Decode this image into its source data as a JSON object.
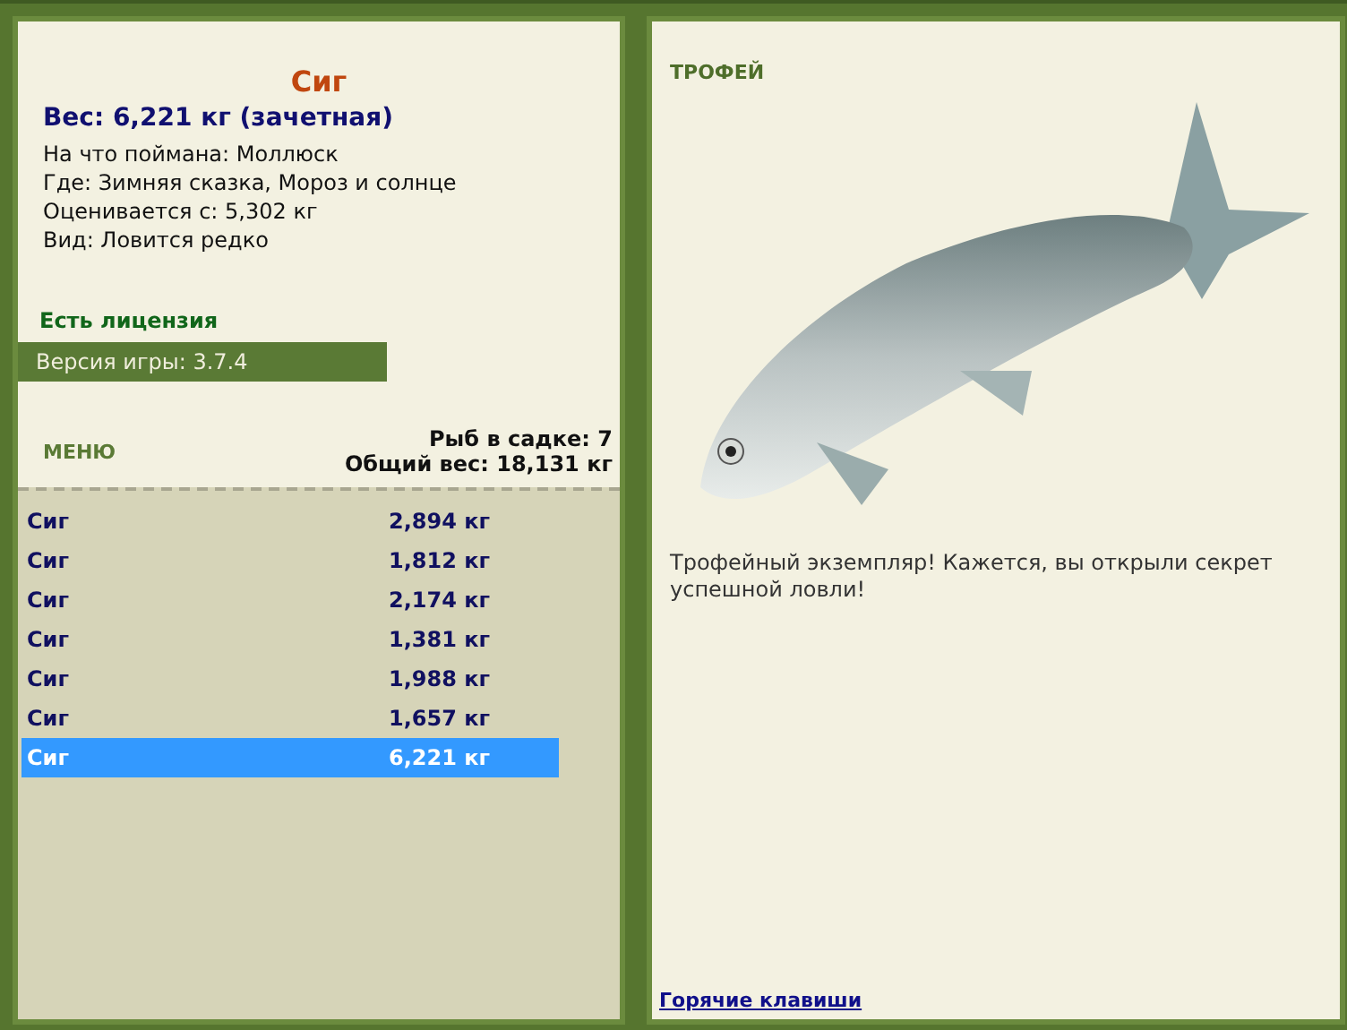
{
  "catch": {
    "title": "Сиг",
    "weight": "Вес: 6,221 кг (зачетная)",
    "details": [
      "На что поймана: Моллюск",
      "Где: Зимняя сказка, Мороз и солнце",
      "Оценивается с: 5,302 кг",
      "Вид: Ловится редко"
    ]
  },
  "license": "Есть лицензия",
  "version": "Версия игры: 3.7.4",
  "menu": {
    "title": "МЕНЮ",
    "stats": [
      "Рыб в садке: 7",
      "Общий вес: 18,131 кг"
    ]
  },
  "keepnet": [
    {
      "name": "Сиг",
      "weight": "2,894 кг",
      "selected": false
    },
    {
      "name": "Сиг",
      "weight": "1,812 кг",
      "selected": false
    },
    {
      "name": "Сиг",
      "weight": "2,174 кг",
      "selected": false
    },
    {
      "name": "Сиг",
      "weight": "1,381 кг",
      "selected": false
    },
    {
      "name": "Сиг",
      "weight": "1,988 кг",
      "selected": false
    },
    {
      "name": "Сиг",
      "weight": "1,657 кг",
      "selected": false
    },
    {
      "name": "Сиг",
      "weight": "6,221 кг",
      "selected": true
    }
  ],
  "trophy": {
    "title": "ТРОФЕЙ",
    "message": "Трофейный экземпляр! Кажется, вы открыли секрет успешной ловли!",
    "link": "Горячие клавиши"
  }
}
